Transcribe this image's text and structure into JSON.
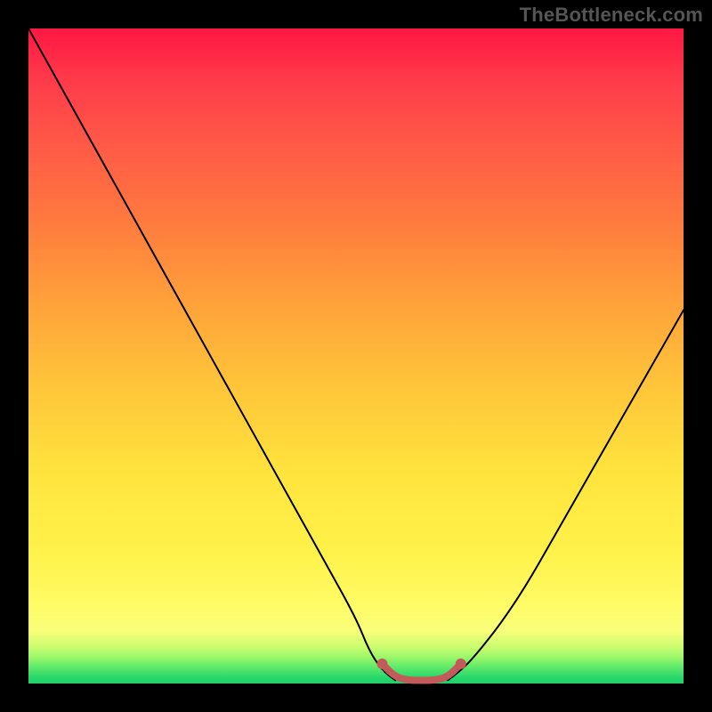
{
  "watermark": "TheBottleneck.com",
  "colors": {
    "background": "#000000",
    "gradient_top": "#ff1744",
    "gradient_mid": "#ffe43d",
    "gradient_bottom": "#1fcf6b",
    "curve": "#000000",
    "highlight": "#c45a5a"
  },
  "chart_data": {
    "type": "line",
    "title": "",
    "xlabel": "",
    "ylabel": "",
    "xlim": [
      0,
      100
    ],
    "ylim": [
      0,
      100
    ],
    "grid": false,
    "legend": false,
    "series": [
      {
        "name": "left-branch",
        "x": [
          0,
          5,
          10,
          15,
          20,
          25,
          30,
          35,
          40,
          45,
          50,
          52,
          54,
          56
        ],
        "values": [
          100,
          91,
          82,
          73,
          64,
          55,
          46,
          37,
          28,
          19,
          10,
          5,
          2,
          0.5
        ]
      },
      {
        "name": "right-branch",
        "x": [
          64,
          66,
          68,
          72,
          76,
          80,
          84,
          88,
          92,
          96,
          100
        ],
        "values": [
          0.5,
          2,
          4,
          9,
          15,
          22,
          29,
          36,
          43,
          50,
          57
        ]
      },
      {
        "name": "valley-highlight",
        "x": [
          54,
          56,
          58,
          60,
          62,
          64,
          66
        ],
        "values": [
          3,
          1,
          0.5,
          0.5,
          0.5,
          1,
          3
        ]
      }
    ],
    "annotations": []
  }
}
